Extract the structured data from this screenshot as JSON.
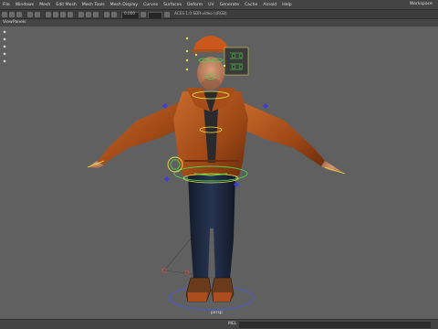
{
  "menubar": {
    "items": [
      "File",
      "Windows",
      "Mesh",
      "Edit Mesh",
      "Mesh Tools",
      "Mesh Display",
      "Curves",
      "Surfaces",
      "Deform",
      "UV",
      "Generate",
      "Cache",
      "Arnold",
      "Help"
    ],
    "workspace": "Workspace"
  },
  "toolbar": {
    "field_text": "0.000",
    "camera_text": "ACES 1.0 SDR-video (sRGB)"
  },
  "panel": {
    "view_label": "View",
    "panels_label": "Panels"
  },
  "viewport": {
    "camera_label": "persp"
  },
  "statusbar": {
    "mel_label": "MEL"
  },
  "colors": {
    "jacket": "#b2561f",
    "jeans": "#1b2639",
    "helmet": "#c9581d",
    "control_yellow": "#e8e241",
    "control_green": "#4bd34b",
    "control_blue": "#3d3dd8",
    "viewport_bg": "#606060"
  }
}
